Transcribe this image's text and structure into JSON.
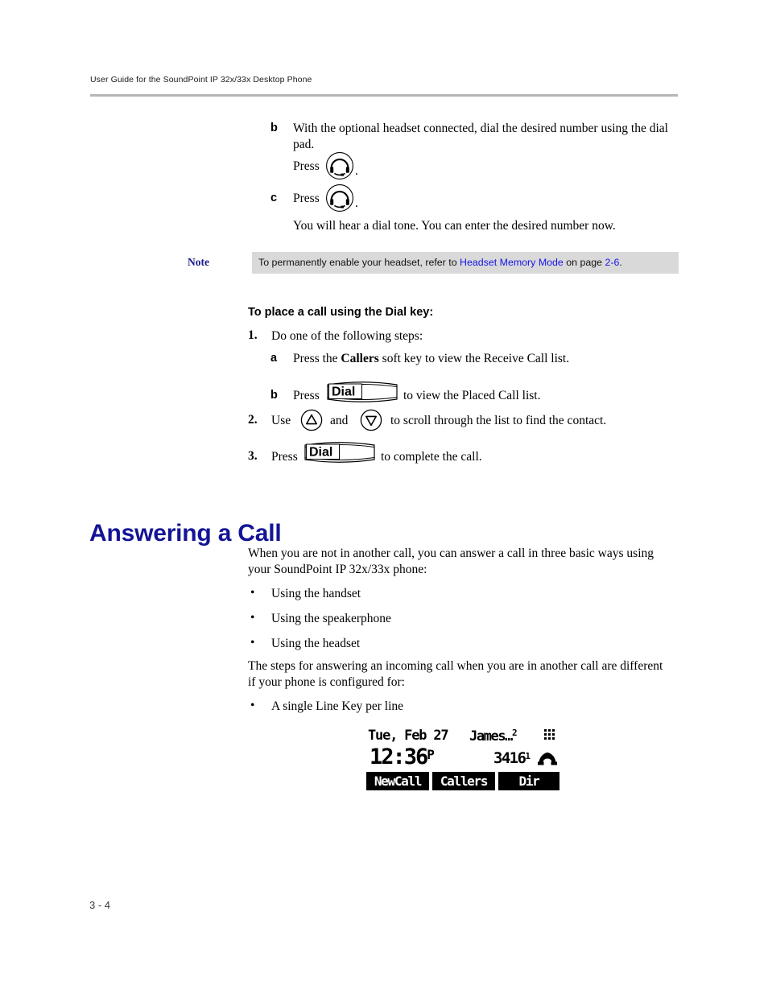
{
  "header": {
    "running_head": "User Guide for the SoundPoint IP 32x/33x Desktop Phone"
  },
  "footer": {
    "page_number": "3 - 4"
  },
  "top_steps": {
    "b_marker": "b",
    "b_text": "With the optional headset connected, dial the desired number using the dial pad.",
    "b_press_label": "Press",
    "b_press_period": ".",
    "c_marker": "c",
    "c_press_label": "Press",
    "c_press_period": ".",
    "c_result_text": "You will hear a dial tone. You can enter the desired number now."
  },
  "note": {
    "label": "Note",
    "text_before": "To permanently enable your headset, refer to ",
    "link_text": "Headset Memory Mode",
    "text_middle": " on page ",
    "link_page": "2-6",
    "text_after": "."
  },
  "procedure": {
    "title": "To place a call using the Dial key:",
    "step1_num": "1.",
    "step1_text": "Do one of the following steps:",
    "step1a_marker": "a",
    "step1a_before": "Press the ",
    "step1a_bold": "Callers",
    "step1a_after": " soft key to view the Receive Call list.",
    "step1b_marker": "b",
    "step1b_before": "Press",
    "step1b_key": "Dial",
    "step1b_after": "to view the Placed Call list.",
    "step2_num": "2.",
    "step2_before": "Use",
    "step2_middle": "and",
    "step2_after": "to scroll through the list to find the contact.",
    "step3_num": "3.",
    "step3_before": "Press",
    "step3_key": "Dial",
    "step3_after": "to complete the call."
  },
  "section": {
    "heading": "Answering a Call",
    "intro": "When you are not in another call, you can answer a call in three basic ways using your SoundPoint IP 32x/33x phone:",
    "bullet_char": "•",
    "bullets": [
      "Using the handset",
      "Using the speakerphone",
      "Using the headset"
    ],
    "second_para": "The steps for answering an incoming call when you are in another call are different if your phone is configured for:",
    "bullets2": [
      "A single Line Key per line"
    ]
  },
  "lcd": {
    "date": "Tue, Feb 27",
    "caller_name": "James…",
    "caller_line_sup": "2",
    "time": "12:36",
    "time_ampm": "P",
    "extension": "3416",
    "extension_sup": "1",
    "softkeys": [
      "NewCall",
      "Callers",
      "Dir"
    ]
  },
  "colors": {
    "heading_blue": "#141496",
    "link_blue": "#1616e8",
    "note_label_blue": "#1a1a8c",
    "note_bg": "#d9d9d9",
    "rule_gray": "#b5b5b5"
  }
}
